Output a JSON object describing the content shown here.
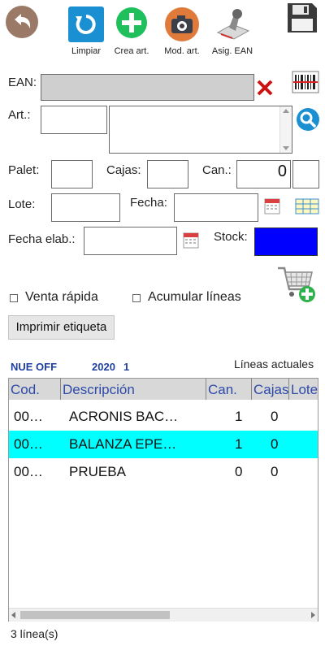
{
  "toolbar": {
    "items": [
      {
        "label": "Limpiar",
        "icon": "refresh-icon"
      },
      {
        "label": "Crea art.",
        "icon": "plus-icon"
      },
      {
        "label": "Mod. art.",
        "icon": "camera-icon"
      },
      {
        "label": "Asig. EAN",
        "icon": "stamp-icon"
      }
    ],
    "back_icon": "back-arrow-icon",
    "save_icon": "floppy-disk-icon"
  },
  "form": {
    "ean_label": "EAN:",
    "ean_value": "",
    "art_label": "Art.:",
    "art_code": "",
    "art_desc": "",
    "palet_label": "Palet:",
    "palet_value": "",
    "cajas_label": "Cajas:",
    "cajas_value": "",
    "can_label": "Can.:",
    "can_value": "0",
    "can_extra": "",
    "lote_label": "Lote:",
    "lote_value": "",
    "fecha_label": "Fecha:",
    "fecha_value": "",
    "fecha_elab_label": "Fecha elab.:",
    "fecha_elab_value": "",
    "stock_label": "Stock:",
    "stock_value": ""
  },
  "options": {
    "venta_rapida": "Venta rápida",
    "acumular_lineas": "Acumular líneas",
    "print_button": "Imprimir etiqueta"
  },
  "info": {
    "code": "NUE OFF",
    "year": "2020",
    "num": "1",
    "lines_title": "Líneas actuales"
  },
  "grid": {
    "columns": [
      "Cod.",
      "Descripción",
      "Can.",
      "Cajas",
      "Lote"
    ],
    "rows": [
      {
        "cod": "00…",
        "desc": "ACRONIS BAC…",
        "can": "1",
        "cajas": "0",
        "selected": false
      },
      {
        "cod": "00…",
        "desc": "BALANZA EPE…",
        "can": "1",
        "cajas": "0",
        "selected": true
      },
      {
        "cod": "00…",
        "desc": "PRUEBA",
        "can": "0",
        "cajas": "0",
        "selected": false
      }
    ],
    "selected_color": "#00ffff"
  },
  "footer": {
    "count": "3 línea(s)"
  },
  "colors": {
    "accent_blue": "#1a8fd1",
    "stock_fill": "#0000ff",
    "delete_red": "#cc1111"
  }
}
